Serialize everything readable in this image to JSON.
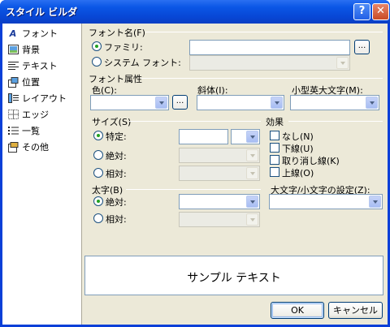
{
  "window": {
    "title": "スタイル ビルダ",
    "help_label": "?",
    "close_label": "✕"
  },
  "sidebar": {
    "items": [
      {
        "label": "フォント",
        "icon": "font-icon"
      },
      {
        "label": "背景",
        "icon": "background-icon"
      },
      {
        "label": "テキスト",
        "icon": "text-icon"
      },
      {
        "label": "位置",
        "icon": "position-icon"
      },
      {
        "label": "レイアウト",
        "icon": "layout-icon"
      },
      {
        "label": "エッジ",
        "icon": "edge-icon"
      },
      {
        "label": "一覧",
        "icon": "list-icon"
      },
      {
        "label": "その他",
        "icon": "other-icon"
      }
    ]
  },
  "font_name": {
    "group_label": "フォント名(F)",
    "family_label": "ファミリ:",
    "system_label": "システム フォント:",
    "family_value": "",
    "browse_label": "..."
  },
  "font_attr": {
    "group_label": "フォント属性",
    "color_label": "色(C):",
    "italic_label": "斜体(I):",
    "smallcaps_label": "小型英大文字(M):",
    "browse_label": "..."
  },
  "size": {
    "group_label": "サイズ(S)",
    "specific_label": "特定:",
    "absolute_label": "絶対:",
    "relative_label": "相対:"
  },
  "effects": {
    "group_label": "効果",
    "none_label": "なし(N)",
    "underline_label": "下線(U)",
    "strikethrough_label": "取り消し線(K)",
    "overline_label": "上線(O)"
  },
  "bold": {
    "group_label": "太字(B)",
    "absolute_label": "絶対:",
    "relative_label": "相対:"
  },
  "capitalization": {
    "label": "大文字/小文字の設定(Z):"
  },
  "preview": {
    "text": "サンプル テキスト"
  },
  "buttons": {
    "ok": "OK",
    "cancel": "キャンセル"
  }
}
